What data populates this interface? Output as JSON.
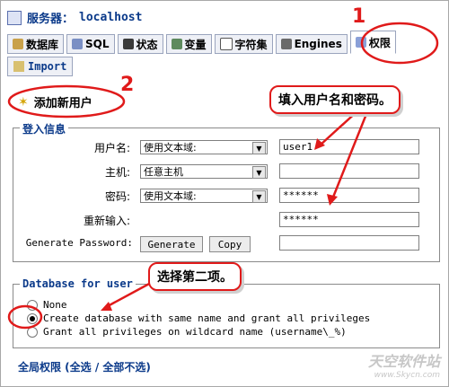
{
  "header": {
    "server_label": "服务器：",
    "server_value": "localhost"
  },
  "tabs": [
    {
      "label": "数据库",
      "icon": "database-icon"
    },
    {
      "label": "SQL",
      "icon": "sql-icon"
    },
    {
      "label": "状态",
      "icon": "status-icon"
    },
    {
      "label": "变量",
      "icon": "variables-icon"
    },
    {
      "label": "字符集",
      "icon": "charset-icon"
    },
    {
      "label": "Engines",
      "icon": "engines-icon"
    },
    {
      "label": "权限",
      "icon": "privileges-icon"
    }
  ],
  "import_tab": {
    "label": "Import"
  },
  "add_user": {
    "label": "添加新用户"
  },
  "login_info": {
    "legend": "登入信息",
    "username_label": "用户名:",
    "username_select": "使用文本域:",
    "username_value": "user1",
    "host_label": "主机:",
    "host_select": "任意主机",
    "password_label": "密码:",
    "password_select": "使用文本域:",
    "password_value": "******",
    "reenter_label": "重新输入:",
    "reenter_value": "******",
    "generate_label": "Generate Password:",
    "generate_button": "Generate",
    "copy_button": "Copy"
  },
  "database_for_user": {
    "legend": "Database for user",
    "options": [
      {
        "label": "None",
        "checked": false
      },
      {
        "label": "Create database with same name and grant all privileges",
        "checked": true
      },
      {
        "label": "Grant all privileges on wildcard name (username\\_%)",
        "checked": false
      }
    ]
  },
  "global_privileges": {
    "label": "全局权限 (全选 / 全部不选)"
  },
  "annotations": {
    "num1": "1",
    "num2": "2",
    "callout_user_pass": "填入用户名和密码。",
    "callout_second": "选择第二项。",
    "accent_color": "#e01a1a"
  },
  "watermark": {
    "main": "天空软件站",
    "sub": "www.Skycn.com"
  }
}
